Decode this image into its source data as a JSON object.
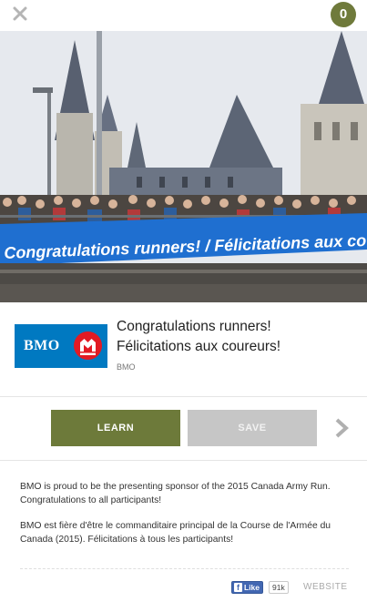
{
  "topbar": {
    "close_icon": "close-x-icon",
    "count": "0",
    "accent_color": "#6f7a3b"
  },
  "hero": {
    "banner_text": "Congratulations runners! / Félicitations aux coureurs!",
    "banner_color": "#1f6fd0"
  },
  "ad": {
    "logo_text": "BMO",
    "logo_color": "#0079c1",
    "logo_roundel_color": "#e21a23",
    "title_line1": "Congratulations runners!",
    "title_line2": "Félicitations aux coureurs!",
    "advertiser": "BMO"
  },
  "actions": {
    "learn_label": "LEARN",
    "save_label": "SAVE",
    "next_icon": "chevron-right-icon"
  },
  "body": {
    "paragraph_en": "BMO is proud to be the presenting sponsor of the 2015 Canada Army Run. Congratulations to all participants!",
    "paragraph_fr": "BMO est fière d'être le commanditaire principal de la Course de l'Armée du Canada (2015). Félicitations à tous les participants!"
  },
  "footer": {
    "like_label": "Like",
    "like_count": "91k",
    "website_label": "WEBSITE"
  }
}
